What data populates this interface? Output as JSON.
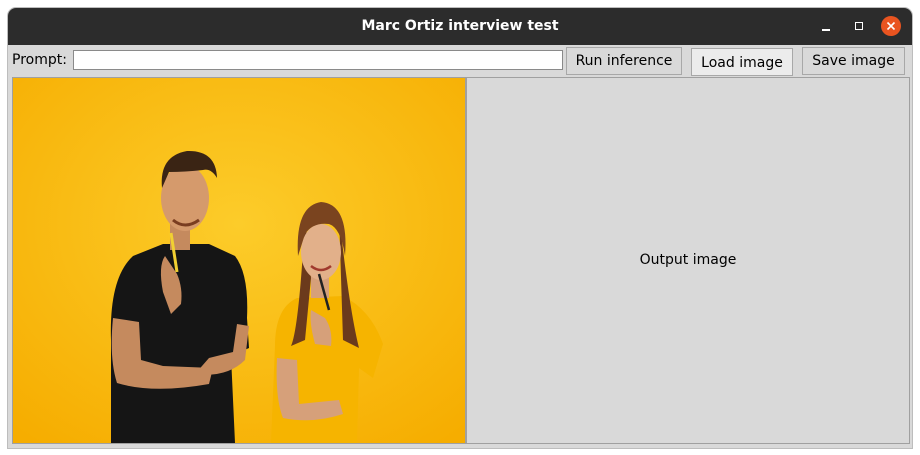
{
  "window": {
    "title": "Marc Ortiz interview test",
    "controls": [
      "minimize-icon",
      "maximize-icon",
      "close-icon"
    ],
    "close_color": "#e95420"
  },
  "toolbar": {
    "prompt_label": "Prompt:",
    "prompt_value": "",
    "run_label": "Run inference",
    "load_label": "Load image",
    "save_label": "Save image"
  },
  "input_panel": {
    "background_color": "#fbb90c"
  },
  "output_panel": {
    "placeholder": "Output image"
  }
}
